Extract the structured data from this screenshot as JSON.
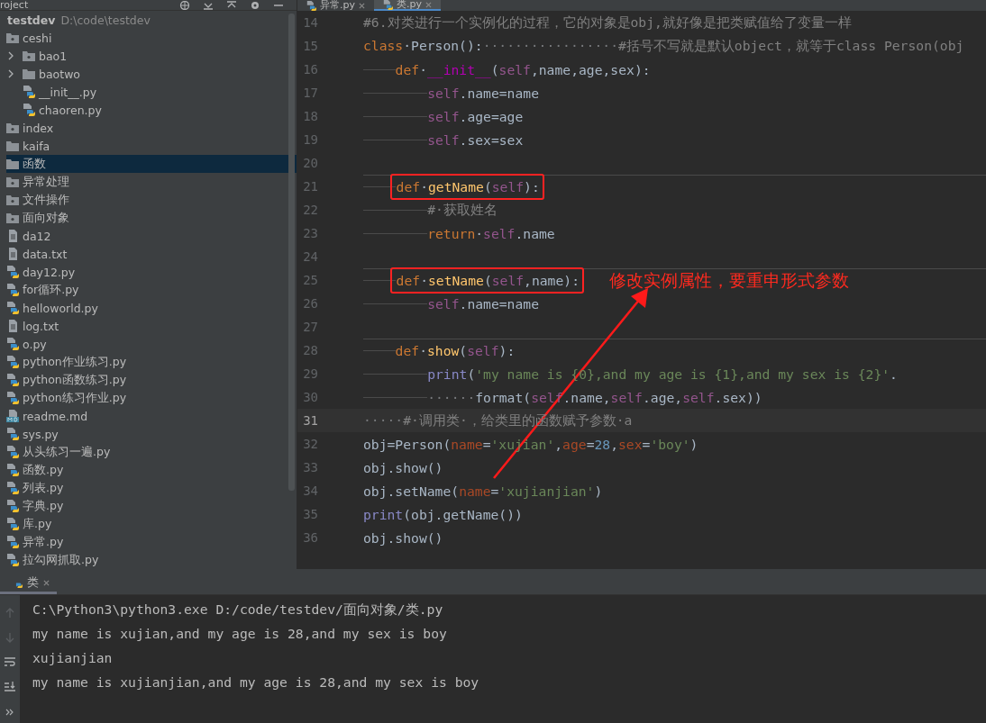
{
  "project_panel": {
    "title": "roject",
    "tree": [
      {
        "label": "testdev",
        "path": "D:\\code\\testdev",
        "kind": "root",
        "selected": false,
        "children": [
          {
            "label": "ceshi",
            "kind": "package",
            "selected": false,
            "children": [
              {
                "label": "bao1",
                "kind": "package",
                "selected": false,
                "expanded": false
              },
              {
                "label": "baotwo",
                "kind": "folder",
                "selected": false,
                "expanded": false
              },
              {
                "label": "__init__.py",
                "kind": "python",
                "selected": false
              },
              {
                "label": "chaoren.py",
                "kind": "python",
                "selected": false
              }
            ]
          },
          {
            "label": "index",
            "kind": "package",
            "selected": false
          },
          {
            "label": "kaifa",
            "kind": "folder",
            "selected": false
          },
          {
            "label": "函数",
            "kind": "folder",
            "selected": true
          },
          {
            "label": "异常处理",
            "kind": "package",
            "selected": false
          },
          {
            "label": "文件操作",
            "kind": "package",
            "selected": false
          },
          {
            "label": "面向对象",
            "kind": "package",
            "selected": false
          },
          {
            "label": "da12",
            "kind": "text",
            "selected": false
          },
          {
            "label": "data.txt",
            "kind": "text",
            "selected": false
          },
          {
            "label": "day12.py",
            "kind": "python",
            "selected": false
          },
          {
            "label": "for循环.py",
            "kind": "python",
            "selected": false
          },
          {
            "label": "helloworld.py",
            "kind": "python",
            "selected": false
          },
          {
            "label": "log.txt",
            "kind": "text",
            "selected": false
          },
          {
            "label": "o.py",
            "kind": "python",
            "selected": false
          },
          {
            "label": "python作业练习.py",
            "kind": "python",
            "selected": false
          },
          {
            "label": "python函数练习.py",
            "kind": "python",
            "selected": false
          },
          {
            "label": "python练习作业.py",
            "kind": "python",
            "selected": false
          },
          {
            "label": "readme.md",
            "kind": "markdown",
            "selected": false
          },
          {
            "label": "sys.py",
            "kind": "python",
            "selected": false
          },
          {
            "label": "从头练习一遍.py",
            "kind": "python",
            "selected": false
          },
          {
            "label": "函数.py",
            "kind": "python",
            "selected": false
          },
          {
            "label": "列表.py",
            "kind": "python",
            "selected": false
          },
          {
            "label": "字典.py",
            "kind": "python",
            "selected": false
          },
          {
            "label": "库.py",
            "kind": "python",
            "selected": false
          },
          {
            "label": "异常.py",
            "kind": "python",
            "selected": false
          },
          {
            "label": "拉勾网抓取.py",
            "kind": "python",
            "selected": false
          }
        ]
      }
    ]
  },
  "editor": {
    "tabs": [
      {
        "label": "异常.py",
        "selected": false
      },
      {
        "label": "类.py",
        "selected": true
      }
    ],
    "lines": [
      {
        "number": "14",
        "current": false,
        "rule": false,
        "tokens": [
          {
            "kind": "comment",
            "text": "#6.对类进行一个实例化的过程，它的对象是obj,就好像是把类赋值给了变量一样"
          }
        ]
      },
      {
        "number": "15",
        "current": false,
        "rule": false,
        "tokens": [
          {
            "kind": "keyword",
            "text": "class"
          },
          {
            "kind": "plain",
            "text": "·Person():"
          },
          {
            "kind": "whitespace",
            "text": "·················"
          },
          {
            "kind": "comment",
            "text": "#括号不写就是默认object，就等于class Person(obj"
          }
        ]
      },
      {
        "number": "16",
        "current": false,
        "rule": false,
        "tokens": [
          {
            "kind": "tab"
          },
          {
            "kind": "keyword",
            "text": "def"
          },
          {
            "kind": "plain",
            "text": "·"
          },
          {
            "kind": "magic",
            "text": "__init__"
          },
          {
            "kind": "plain",
            "text": "("
          },
          {
            "kind": "self",
            "text": "self"
          },
          {
            "kind": "plain",
            "text": ",name,age,sex):"
          }
        ]
      },
      {
        "number": "17",
        "current": false,
        "rule": false,
        "tokens": [
          {
            "kind": "tab"
          },
          {
            "kind": "tab"
          },
          {
            "kind": "self",
            "text": "self"
          },
          {
            "kind": "plain",
            "text": ".name=name"
          }
        ]
      },
      {
        "number": "18",
        "current": false,
        "rule": false,
        "tokens": [
          {
            "kind": "tab"
          },
          {
            "kind": "tab"
          },
          {
            "kind": "self",
            "text": "self"
          },
          {
            "kind": "plain",
            "text": ".age=age"
          }
        ]
      },
      {
        "number": "19",
        "current": false,
        "rule": false,
        "tokens": [
          {
            "kind": "tab"
          },
          {
            "kind": "tab"
          },
          {
            "kind": "self",
            "text": "self"
          },
          {
            "kind": "plain",
            "text": ".sex=sex"
          }
        ]
      },
      {
        "number": "20",
        "current": false,
        "rule": false
      },
      {
        "number": "21",
        "current": false,
        "rule": true,
        "boxed": true,
        "tokens": [
          {
            "kind": "tab"
          },
          {
            "kind": "keyword",
            "text": "def"
          },
          {
            "kind": "plain",
            "text": "·"
          },
          {
            "kind": "func",
            "text": "getName"
          },
          {
            "kind": "plain",
            "text": "("
          },
          {
            "kind": "self",
            "text": "self"
          },
          {
            "kind": "plain",
            "text": "):"
          }
        ]
      },
      {
        "number": "22",
        "current": false,
        "rule": false,
        "tokens": [
          {
            "kind": "tab"
          },
          {
            "kind": "tab"
          },
          {
            "kind": "comment",
            "text": "#·获取姓名"
          }
        ]
      },
      {
        "number": "23",
        "current": false,
        "rule": false,
        "tokens": [
          {
            "kind": "tab"
          },
          {
            "kind": "tab"
          },
          {
            "kind": "keyword",
            "text": "return"
          },
          {
            "kind": "plain",
            "text": "·"
          },
          {
            "kind": "self",
            "text": "self"
          },
          {
            "kind": "plain",
            "text": ".name"
          }
        ]
      },
      {
        "number": "24",
        "current": false,
        "rule": false
      },
      {
        "number": "25",
        "current": false,
        "rule": true,
        "boxed": true,
        "note": "修改实例属性，要重申形式参数",
        "tokens": [
          {
            "kind": "tab"
          },
          {
            "kind": "keyword",
            "text": "def"
          },
          {
            "kind": "plain",
            "text": "·"
          },
          {
            "kind": "func",
            "text": "setName"
          },
          {
            "kind": "plain",
            "text": "("
          },
          {
            "kind": "self",
            "text": "self"
          },
          {
            "kind": "plain",
            "text": ",name):"
          }
        ]
      },
      {
        "number": "26",
        "current": false,
        "rule": false,
        "tokens": [
          {
            "kind": "tab"
          },
          {
            "kind": "tab"
          },
          {
            "kind": "self",
            "text": "self"
          },
          {
            "kind": "plain",
            "text": ".name=name"
          }
        ]
      },
      {
        "number": "27",
        "current": false,
        "rule": false
      },
      {
        "number": "28",
        "current": false,
        "rule": true,
        "tokens": [
          {
            "kind": "tab"
          },
          {
            "kind": "keyword",
            "text": "def"
          },
          {
            "kind": "plain",
            "text": "·"
          },
          {
            "kind": "func",
            "text": "show"
          },
          {
            "kind": "plain",
            "text": "("
          },
          {
            "kind": "self",
            "text": "self"
          },
          {
            "kind": "plain",
            "text": "):"
          }
        ]
      },
      {
        "number": "29",
        "current": false,
        "rule": false,
        "tokens": [
          {
            "kind": "tab"
          },
          {
            "kind": "tab"
          },
          {
            "kind": "builtin",
            "text": "print"
          },
          {
            "kind": "plain",
            "text": "("
          },
          {
            "kind": "string",
            "text": "'my name is {0},and my age is {1},and my sex is {2}'"
          },
          {
            "kind": "plain",
            "text": "."
          }
        ]
      },
      {
        "number": "30",
        "current": false,
        "rule": false,
        "tokens": [
          {
            "kind": "tab"
          },
          {
            "kind": "tab"
          },
          {
            "kind": "whitespace",
            "text": "······"
          },
          {
            "kind": "plain",
            "text": "format("
          },
          {
            "kind": "self",
            "text": "self"
          },
          {
            "kind": "plain",
            "text": ".name,"
          },
          {
            "kind": "self",
            "text": "self"
          },
          {
            "kind": "plain",
            "text": ".age,"
          },
          {
            "kind": "self",
            "text": "self"
          },
          {
            "kind": "plain",
            "text": ".sex))"
          }
        ]
      },
      {
        "number": "31",
        "current": true,
        "rule": false,
        "tokens": [
          {
            "kind": "whitespace",
            "text": "·····"
          },
          {
            "kind": "comment",
            "text": "#·调用类·，给类里的函数赋予参数·a"
          }
        ]
      },
      {
        "number": "32",
        "current": false,
        "rule": false,
        "tokens": [
          {
            "kind": "plain",
            "text": "obj=Person("
          },
          {
            "kind": "param",
            "text": "name"
          },
          {
            "kind": "plain",
            "text": "="
          },
          {
            "kind": "string",
            "text": "'xujian'"
          },
          {
            "kind": "plain",
            "text": ","
          },
          {
            "kind": "param",
            "text": "age"
          },
          {
            "kind": "plain",
            "text": "="
          },
          {
            "kind": "number",
            "text": "28"
          },
          {
            "kind": "plain",
            "text": ","
          },
          {
            "kind": "param",
            "text": "sex"
          },
          {
            "kind": "plain",
            "text": "="
          },
          {
            "kind": "string",
            "text": "'boy'"
          },
          {
            "kind": "plain",
            "text": ")"
          }
        ]
      },
      {
        "number": "33",
        "current": false,
        "rule": false,
        "tokens": [
          {
            "kind": "plain",
            "text": "obj.show()"
          }
        ]
      },
      {
        "number": "34",
        "current": false,
        "rule": false,
        "tokens": [
          {
            "kind": "plain",
            "text": "obj.setName("
          },
          {
            "kind": "param",
            "text": "name"
          },
          {
            "kind": "plain",
            "text": "="
          },
          {
            "kind": "string",
            "text": "'xujianjian'"
          },
          {
            "kind": "plain",
            "text": ")"
          }
        ]
      },
      {
        "number": "35",
        "current": false,
        "rule": false,
        "tokens": [
          {
            "kind": "builtin",
            "text": "print"
          },
          {
            "kind": "plain",
            "text": "(obj.getName())"
          }
        ]
      },
      {
        "number": "36",
        "current": false,
        "rule": false,
        "tokens": [
          {
            "kind": "plain",
            "text": "obj.show()"
          }
        ]
      }
    ]
  },
  "run_panel": {
    "tabs": [
      {
        "label": "类",
        "selected": true
      }
    ],
    "output": [
      "C:\\Python3\\python3.exe D:/code/testdev/面向对象/类.py",
      "my name is xujian,and my age is 28,and my sex is boy",
      "xujianjian",
      "my name is xujianjian,and my age is 28,and my sex is boy"
    ]
  }
}
